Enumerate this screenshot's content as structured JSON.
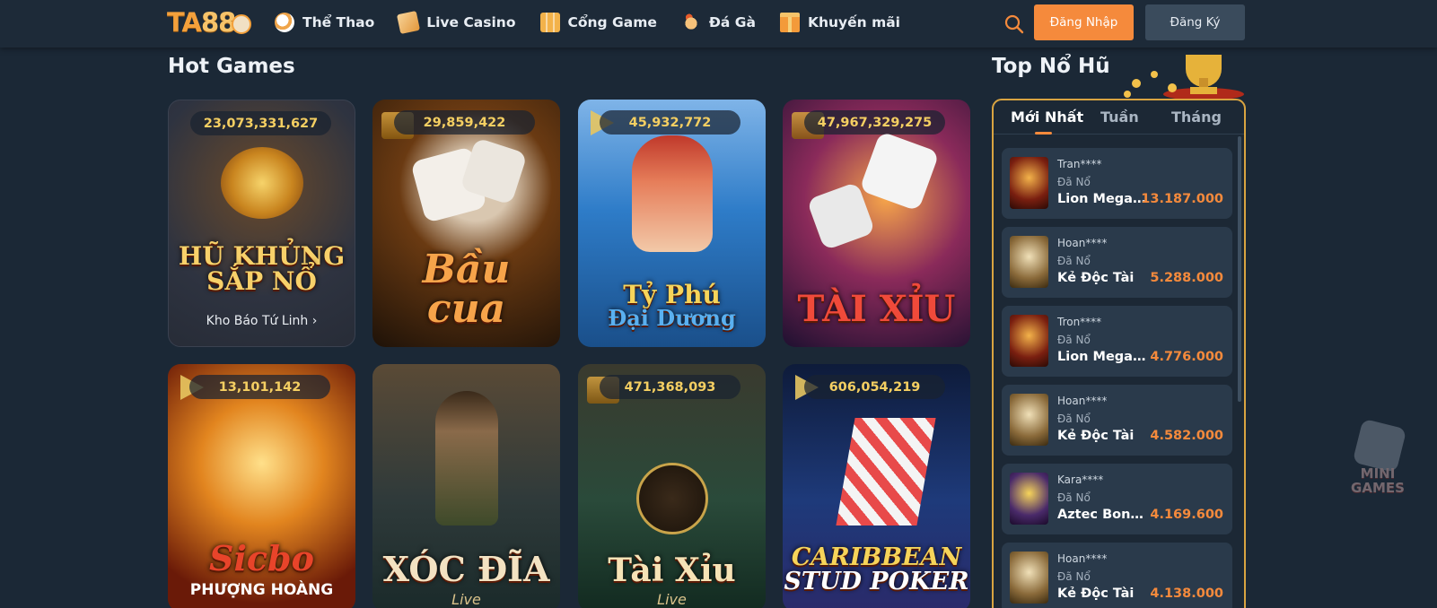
{
  "header": {
    "logo_text_a": "TA",
    "logo_text_b": "88",
    "nav": [
      {
        "label": "Thể Thao",
        "icon": "sports-ball-icon"
      },
      {
        "label": "Live Casino",
        "icon": "playing-card-icon"
      },
      {
        "label": "Cổng Game",
        "icon": "slot-machine-icon"
      },
      {
        "label": "Đá Gà",
        "icon": "rooster-icon"
      },
      {
        "label": "Khuyến mãi",
        "icon": "gift-icon"
      }
    ],
    "login_label": "Đăng Nhập",
    "register_label": "Đăng Ký"
  },
  "hot_games": {
    "title": "Hot Games",
    "cards": [
      {
        "jackpot": "23,073,331,627",
        "title_line1": "HŨ KHỦNG",
        "title_line2": "SẮP NỔ",
        "link": "Kho Báo Tứ Linh ›",
        "theme": "#2a2f3a"
      },
      {
        "jackpot": "29,859,422",
        "title_line1": "Bầu",
        "title_line2": "cua",
        "theme": "#3a200d"
      },
      {
        "jackpot": "45,932,772",
        "title_line1": "Tỷ Phú",
        "title_line2": "Đại Dương",
        "theme": "#2a6fb0"
      },
      {
        "jackpot": "47,967,329,275",
        "title_line1": "TÀI XỈU",
        "title_line2": "",
        "theme": "#3a1a4a"
      },
      {
        "jackpot": "13,101,142",
        "title_line1": "Sicbo",
        "title_line2": "PHƯỢNG HOÀNG",
        "theme": "#6a2a0a"
      },
      {
        "jackpot": "",
        "title_line1": "XÓC ĐĨA",
        "title_line2": "Live",
        "theme": "#2e3a3a"
      },
      {
        "jackpot": "471,368,093",
        "title_line1": "Tài Xỉu",
        "title_line2": "Live",
        "theme": "#1f3a30"
      },
      {
        "jackpot": "606,054,219",
        "title_line1": "CARIBBEAN",
        "title_line2": "STUD POKER",
        "theme": "#1a2a5a"
      }
    ]
  },
  "top_jackpot": {
    "title": "Top Nổ Hũ",
    "tabs": [
      "Mới Nhất",
      "Tuần",
      "Tháng"
    ],
    "active_tab": "Mới Nhất",
    "rows": [
      {
        "user": "Tran****",
        "status": "Đã Nổ",
        "game": "Lion Megaways",
        "amount": "13.187.000",
        "thumb": "#7a1f10"
      },
      {
        "user": "Hoan****",
        "status": "Đã Nổ",
        "game": "Kẻ Độc Tài",
        "amount": "5.288.000",
        "thumb": "#8a6a3a"
      },
      {
        "user": "Tron****",
        "status": "Đã Nổ",
        "game": "Lion Megaways",
        "amount": "4.776.000",
        "thumb": "#7a1f10"
      },
      {
        "user": "Hoan****",
        "status": "Đã Nổ",
        "game": "Kẻ Độc Tài",
        "amount": "4.582.000",
        "thumb": "#8a6a3a"
      },
      {
        "user": "Kara****",
        "status": "Đã Nổ",
        "game": "Aztec Bonanza",
        "amount": "4.169.600",
        "thumb": "#4a2a6a"
      },
      {
        "user": "Hoan****",
        "status": "Đã Nổ",
        "game": "Kẻ Độc Tài",
        "amount": "4.138.000",
        "thumb": "#8a6a3a"
      }
    ]
  },
  "mini_games": {
    "line1": "MINI",
    "line2": "GAMES"
  }
}
